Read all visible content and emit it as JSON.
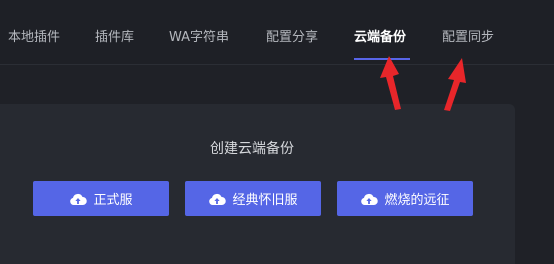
{
  "tabs": [
    {
      "label": "本地插件"
    },
    {
      "label": "插件库"
    },
    {
      "label": "WA字符串"
    },
    {
      "label": "配置分享"
    },
    {
      "label": "云端备份"
    },
    {
      "label": "配置同步"
    }
  ],
  "active_tab": "云端备份",
  "panel": {
    "title": "创建云端备份",
    "buttons": [
      {
        "label": "正式服",
        "icon": "cloud-upload-icon"
      },
      {
        "label": "经典怀旧服",
        "icon": "cloud-upload-icon"
      },
      {
        "label": "燃烧的远征",
        "icon": "cloud-upload-icon"
      }
    ]
  },
  "colors": {
    "background": "#1f2127",
    "panel": "#272a31",
    "accent": "#5566e6",
    "annotation_arrow": "#e8262a"
  }
}
